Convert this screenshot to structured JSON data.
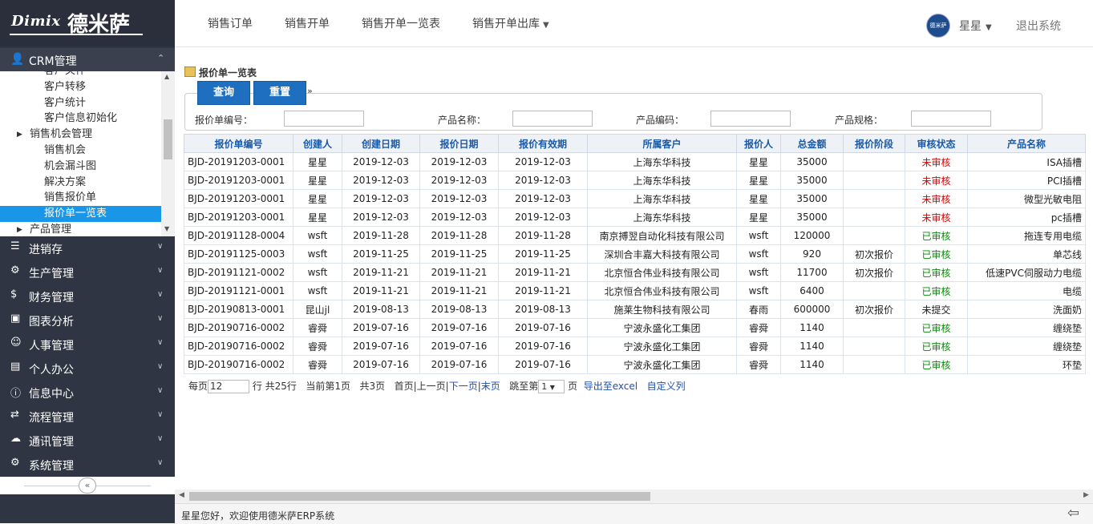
{
  "brand": {
    "latin": "Dimix",
    "chinese": "德米萨"
  },
  "sidebar": {
    "crm": {
      "label": "CRM管理",
      "icon": "user-icon"
    },
    "crm_items": [
      {
        "label": "客户关怀",
        "type": "item"
      },
      {
        "label": "客户转移",
        "type": "item"
      },
      {
        "label": "客户统计",
        "type": "item"
      },
      {
        "label": "客户信息初始化",
        "type": "item"
      },
      {
        "label": "销售机会管理",
        "type": "group"
      },
      {
        "label": "销售机会",
        "type": "item"
      },
      {
        "label": "机会漏斗图",
        "type": "item"
      },
      {
        "label": "解决方案",
        "type": "item"
      },
      {
        "label": "销售报价单",
        "type": "item"
      },
      {
        "label": "报价单一览表",
        "type": "active"
      },
      {
        "label": "产品管理",
        "type": "group"
      }
    ],
    "menus": [
      {
        "label": "进销存",
        "icon": "list-icon"
      },
      {
        "label": "生产管理",
        "icon": "gears-icon"
      },
      {
        "label": "财务管理",
        "icon": "dollar-icon"
      },
      {
        "label": "图表分析",
        "icon": "image-icon"
      },
      {
        "label": "人事管理",
        "icon": "users-icon"
      },
      {
        "label": "个人办公",
        "icon": "briefcase-icon"
      },
      {
        "label": "信息中心",
        "icon": "info-icon"
      },
      {
        "label": "流程管理",
        "icon": "exchange-icon"
      },
      {
        "label": "通讯管理",
        "icon": "chat-icon"
      },
      {
        "label": "系统管理",
        "icon": "gear-icon"
      }
    ]
  },
  "topnav": {
    "links": [
      "销售订单",
      "销售开单",
      "销售开单一览表",
      "销售开单出库"
    ],
    "avatar_text": "德米萨",
    "user": "星星",
    "logout": "退出系统"
  },
  "page": {
    "title": "报价单一览表",
    "query_btn": "查询",
    "reset_btn": "重置",
    "filters": [
      "报价单编号：",
      "产品名称：",
      "产品编码：",
      "产品规格："
    ]
  },
  "table": {
    "headers": [
      "报价单编号",
      "创建人",
      "创建日期",
      "报价日期",
      "报价有效期",
      "所属客户",
      "报价人",
      "总金额",
      "报价阶段",
      "审核状态",
      "产品名称"
    ],
    "rows": [
      [
        "BJD-20191203-0001",
        "星星",
        "2019-12-03",
        "2019-12-03",
        "2019-12-03",
        "上海东华科技",
        "星星",
        "35000",
        "",
        "未审核",
        "ISA插槽"
      ],
      [
        "BJD-20191203-0001",
        "星星",
        "2019-12-03",
        "2019-12-03",
        "2019-12-03",
        "上海东华科技",
        "星星",
        "35000",
        "",
        "未审核",
        "PCI插槽"
      ],
      [
        "BJD-20191203-0001",
        "星星",
        "2019-12-03",
        "2019-12-03",
        "2019-12-03",
        "上海东华科技",
        "星星",
        "35000",
        "",
        "未审核",
        "微型光敏电阻"
      ],
      [
        "BJD-20191203-0001",
        "星星",
        "2019-12-03",
        "2019-12-03",
        "2019-12-03",
        "上海东华科技",
        "星星",
        "35000",
        "",
        "未审核",
        "pc插槽"
      ],
      [
        "BJD-20191128-0004",
        "wsft",
        "2019-11-28",
        "2019-11-28",
        "2019-11-28",
        "南京搏翌自动化科技有限公司",
        "wsft",
        "120000",
        "",
        "已审核",
        "拖连专用电缆"
      ],
      [
        "BJD-20191125-0003",
        "wsft",
        "2019-11-25",
        "2019-11-25",
        "2019-11-25",
        "深圳合丰嘉大科技有限公司",
        "wsft",
        "920",
        "初次报价",
        "已审核",
        "单芯线"
      ],
      [
        "BJD-20191121-0002",
        "wsft",
        "2019-11-21",
        "2019-11-21",
        "2019-11-21",
        "北京恒合伟业科技有限公司",
        "wsft",
        "11700",
        "初次报价",
        "已审核",
        "低速PVC伺服动力电缆"
      ],
      [
        "BJD-20191121-0001",
        "wsft",
        "2019-11-21",
        "2019-11-21",
        "2019-11-21",
        "北京恒合伟业科技有限公司",
        "wsft",
        "6400",
        "",
        "已审核",
        "电缆"
      ],
      [
        "BJD-20190813-0001",
        "昆山jl",
        "2019-08-13",
        "2019-08-13",
        "2019-08-13",
        "施莱生物科技有限公司",
        "春雨",
        "600000",
        "初次报价",
        "未提交",
        "洗面奶"
      ],
      [
        "BJD-20190716-0002",
        "睿舜",
        "2019-07-16",
        "2019-07-16",
        "2019-07-16",
        "宁波永盛化工集团",
        "睿舜",
        "1140",
        "",
        "已审核",
        "缠绕垫"
      ],
      [
        "BJD-20190716-0002",
        "睿舜",
        "2019-07-16",
        "2019-07-16",
        "2019-07-16",
        "宁波永盛化工集团",
        "睿舜",
        "1140",
        "",
        "已审核",
        "缠绕垫"
      ],
      [
        "BJD-20190716-0002",
        "睿舜",
        "2019-07-16",
        "2019-07-16",
        "2019-07-16",
        "宁波永盛化工集团",
        "睿舜",
        "1140",
        "",
        "已审核",
        "环垫"
      ]
    ]
  },
  "pager": {
    "per_page_label": "每页",
    "per_page_value": "12",
    "total_text": "行 共25行",
    "current_text": "当前第1页",
    "pages_text": "共3页",
    "first": "首页",
    "prev": "上一页",
    "next": "下一页",
    "last": "末页",
    "jump_label": "跳至第",
    "jump_value": "1",
    "page_unit": "页",
    "export": "导出至excel",
    "custom_cols": "自定义列"
  },
  "footer": {
    "message": "星星您好，欢迎使用德米萨ERP系统"
  },
  "colors": {
    "sidebar": "#2f3542",
    "active": "#1a96e8",
    "button": "#1f6fc0",
    "header_text": "#1a5aa8",
    "unapproved": "#dd0000",
    "approved": "#0a8a0a"
  }
}
